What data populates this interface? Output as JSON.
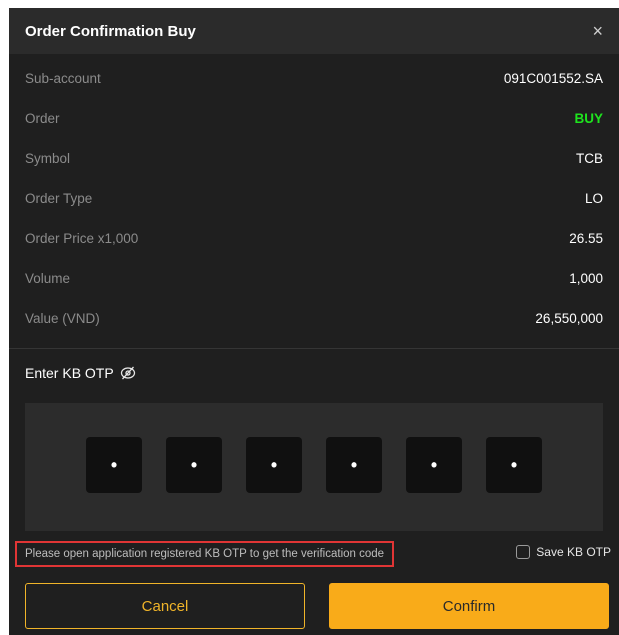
{
  "header": {
    "title": "Order Confirmation Buy",
    "close_glyph": "×"
  },
  "rows": [
    {
      "label": "Sub-account",
      "value": "091C001552.SA"
    },
    {
      "label": "Order",
      "value": "BUY"
    },
    {
      "label": "Symbol",
      "value": "TCB"
    },
    {
      "label": "Order Type",
      "value": "LO"
    },
    {
      "label": "Order Price x1,000",
      "value": "26.55"
    },
    {
      "label": "Volume",
      "value": "1,000"
    },
    {
      "label": "Value (VND)",
      "value": "26,550,000"
    }
  ],
  "otp": {
    "label": "Enter KB OTP",
    "visibility_icon": "eye-off-icon",
    "digits": [
      "•",
      "•",
      "•",
      "•",
      "•",
      "•"
    ]
  },
  "note": "Please open application registered KB OTP to get the verification code",
  "save_otp": {
    "label": "Save KB OTP",
    "checked": false
  },
  "buttons": {
    "cancel": "Cancel",
    "confirm": "Confirm"
  },
  "colors": {
    "accent": "#f9ab19",
    "buy": "#1ee31e",
    "note_border": "#e03535",
    "background": "#1f1f1f"
  }
}
